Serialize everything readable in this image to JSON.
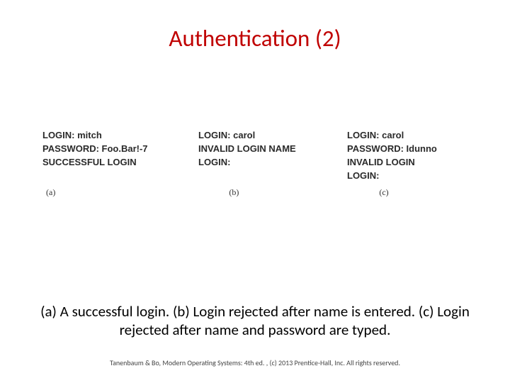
{
  "title": "Authentication (2)",
  "panels": {
    "a": {
      "line1": "LOGIN: mitch",
      "line2": "PASSWORD: Foo.Bar!-7",
      "line3": "SUCCESSFUL LOGIN",
      "label": "(a)"
    },
    "b": {
      "line1": "LOGIN: carol",
      "line2": "INVALID LOGIN NAME",
      "line3": "LOGIN:",
      "label": "(b)"
    },
    "c": {
      "line1": "LOGIN: carol",
      "line2": "PASSWORD: Idunno",
      "line3": "INVALID LOGIN",
      "line4": "LOGIN:",
      "label": "(c)"
    }
  },
  "caption": "(a) A successful login. (b) Login rejected after name is entered. (c) Login rejected after name and password are typed.",
  "footer": "Tanenbaum & Bo, Modern  Operating Systems: 4th ed. , (c) 2013 Prentice-Hall, Inc. All rights reserved."
}
